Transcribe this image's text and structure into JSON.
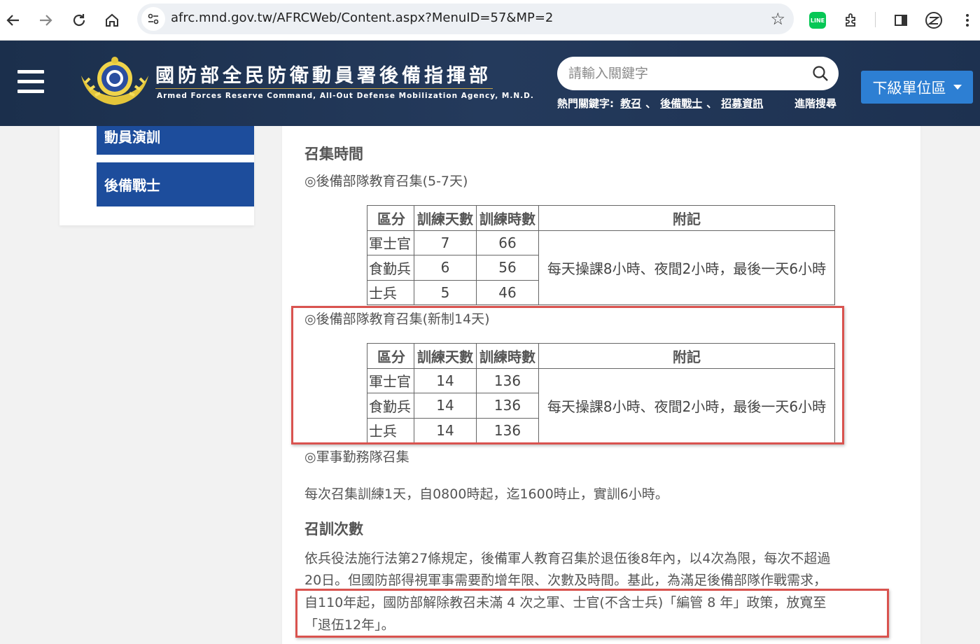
{
  "browser": {
    "url": "afrc.mnd.gov.tw/AFRCWeb/Content.aspx?MenuID=57&MP=2",
    "line_ext_label": "LINE",
    "icons": [
      "back-icon",
      "forward-icon",
      "reload-icon",
      "home-icon",
      "site-settings-icon",
      "bookmark-star-icon",
      "line-extension-icon",
      "extensions-icon",
      "side-panel-icon",
      "profile-icon",
      "menu-icon"
    ]
  },
  "header": {
    "title": "國防部全民防衛動員署後備指揮部",
    "subtitle": "Armed Forces Reserve Command, All-Out Defense Mobilization Agency, M.N.D.",
    "search_placeholder": "請輸入關鍵字",
    "hot_label": "熱門關鍵字:",
    "hot_keywords": [
      "教召",
      "後備戰士",
      "招募資訊"
    ],
    "hot_sep": "、",
    "advanced_search": "進階搜尋",
    "sub_units": "下級單位區"
  },
  "sidebar": {
    "items": [
      {
        "label": "動員演訓"
      },
      {
        "label": "後備戰士"
      }
    ]
  },
  "content": {
    "section1_title": "召集時間",
    "table1_caption": "◎後備部隊教育召集(5-7天)",
    "headers": [
      "區分",
      "訓練天數",
      "訓練時數",
      "附記"
    ],
    "table1_rows": [
      {
        "category": "軍士官",
        "days": "7",
        "hours": "66"
      },
      {
        "category": "食勤兵",
        "days": "6",
        "hours": "56"
      },
      {
        "category": "士兵",
        "days": "5",
        "hours": "46"
      }
    ],
    "table_note": "每天操課8小時、夜間2小時，最後一天6小時",
    "table2_caption": "◎後備部隊教育召集(新制14天)",
    "table2_rows": [
      {
        "category": "軍士官",
        "days": "14",
        "hours": "136"
      },
      {
        "category": "食勤兵",
        "days": "14",
        "hours": "136"
      },
      {
        "category": "士兵",
        "days": "14",
        "hours": "136"
      }
    ],
    "duty_caption": "◎軍事勤務隊召集",
    "duty_text": "每次召集訓練1天，自0800時起，迄1600時止，實訓6小時。",
    "section2_title": "召訓次數",
    "para_lines": [
      "依兵役法施行法第27條規定，後備軍人教育召集於退伍後8年內，以4次為限，每次不超過",
      "20日。但國防部得視軍事需要酌增年限、次數及時間。基此，為滿足後備部隊作戰需求，",
      "自110年起，國防部解除教召未滿 4 次之軍、士官(不含士兵)「編管 8 年」政策，放寬至",
      "「退伍12年」。"
    ],
    "highlight_color": "#d9534f"
  }
}
